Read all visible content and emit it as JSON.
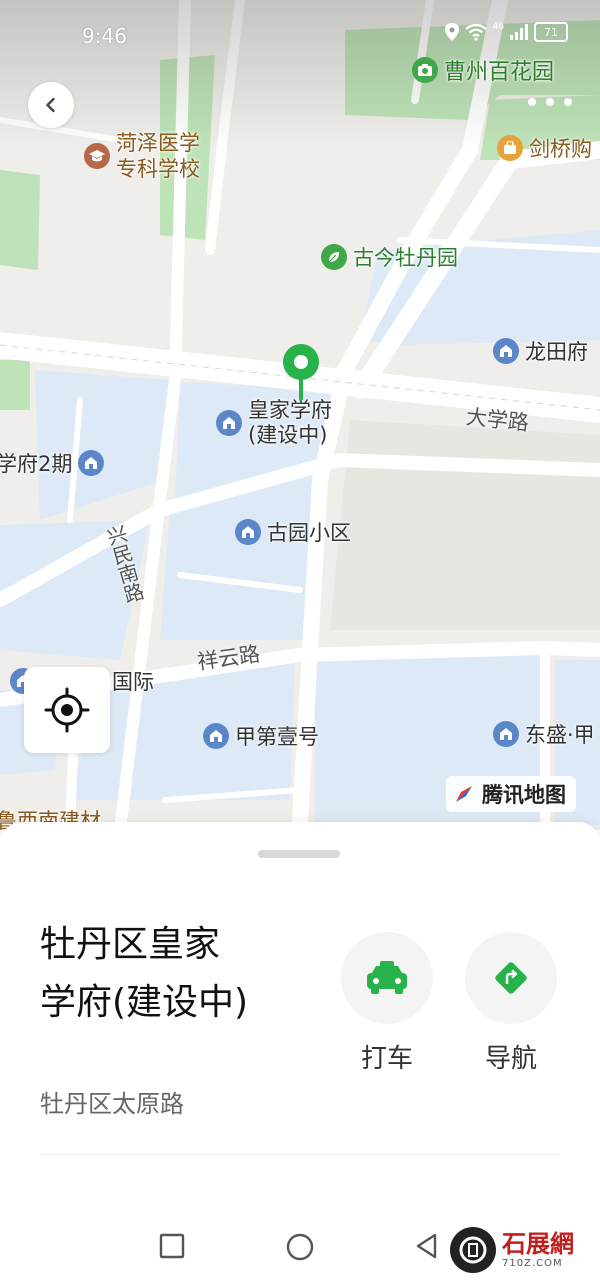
{
  "status_bar": {
    "time": "9:46",
    "network": "46",
    "battery": "71"
  },
  "map": {
    "pois": [
      {
        "name": "曹州百花园",
        "icon": "camera-icon"
      },
      {
        "name": "菏泽医学专科学校",
        "lines": [
          "菏泽医学",
          "专科学校"
        ],
        "icon": "school-icon"
      },
      {
        "name": "剑桥购",
        "icon": "shopping-bag-icon"
      },
      {
        "name": "古今牡丹园",
        "icon": "leaf-icon"
      },
      {
        "name": "龙田府",
        "icon": "house-icon"
      },
      {
        "name": "皇家学府(建设中)",
        "lines": [
          "皇家学府",
          "(建设中)"
        ],
        "icon": "house-icon"
      },
      {
        "name": "学府2期",
        "icon": "house-icon"
      },
      {
        "name": "古园小区",
        "icon": "house-icon"
      },
      {
        "name": "国际",
        "icon": "house-icon"
      },
      {
        "name": "甲第壹号",
        "icon": "house-icon"
      },
      {
        "name": "东盛·甲",
        "icon": "house-icon"
      },
      {
        "name": "鲁西南建材",
        "icon": ""
      }
    ],
    "roads": [
      "大学路",
      "兴民南路",
      "祥云路"
    ],
    "brand": "腾讯地图"
  },
  "place": {
    "title": "牡丹区皇家学府(建设中)",
    "title_lines": [
      "牡丹区皇家",
      "学府(建设中)"
    ],
    "address": "牡丹区太原路"
  },
  "actions": [
    {
      "label": "打车",
      "icon": "taxi-icon",
      "color": "#27b34a"
    },
    {
      "label": "导航",
      "icon": "navigation-icon",
      "color": "#27b34a"
    }
  ],
  "watermark": {
    "name": "石展網",
    "url": "710Z.COM"
  },
  "colors": {
    "accent": "#27b34a",
    "block": "#dde9f6",
    "park": "#bfe3b8"
  }
}
